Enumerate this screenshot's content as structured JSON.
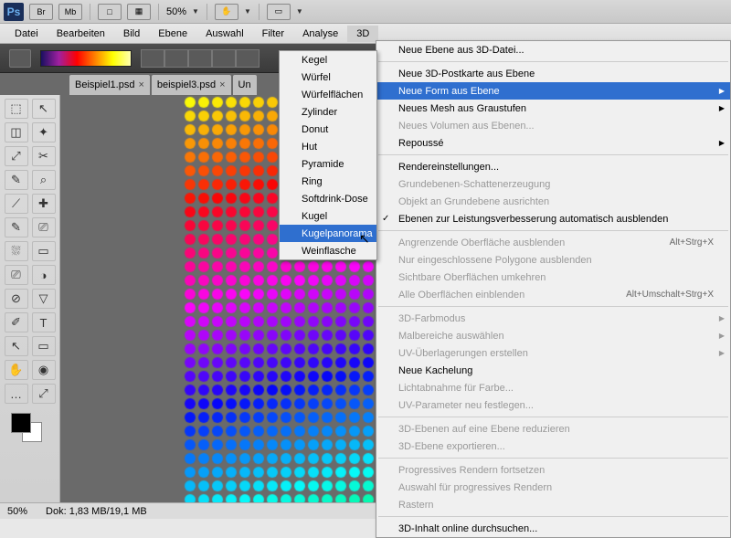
{
  "titlebar": {
    "logo": "Ps",
    "boxes": [
      "Br",
      "Mb",
      "□",
      "▦"
    ],
    "zoom": "50%"
  },
  "menubar": [
    "Datei",
    "Bearbeiten",
    "Bild",
    "Ebene",
    "Auswahl",
    "Filter",
    "Analyse",
    "3D"
  ],
  "tabs": [
    {
      "name": "Beispiel1.psd"
    },
    {
      "name": "beispiel3.psd"
    },
    {
      "name": "Un"
    }
  ],
  "menu3d": [
    {
      "label": "Neue Ebene aus 3D-Datei..."
    },
    {
      "sep": true
    },
    {
      "label": "Neue 3D-Postkarte aus Ebene"
    },
    {
      "label": "Neue Form aus Ebene",
      "arrow": true,
      "highlighted": true
    },
    {
      "label": "Neues Mesh aus Graustufen",
      "arrow": true
    },
    {
      "label": "Neues Volumen aus Ebenen...",
      "disabled": true
    },
    {
      "label": "Repoussé",
      "arrow": true
    },
    {
      "sep": true
    },
    {
      "label": "Rendereinstellungen..."
    },
    {
      "label": "Grundebenen-Schattenerzeugung",
      "disabled": true
    },
    {
      "label": "Objekt an Grundebene ausrichten",
      "disabled": true
    },
    {
      "label": "Ebenen zur Leistungsverbesserung automatisch ausblenden",
      "checked": true
    },
    {
      "sep": true
    },
    {
      "label": "Angrenzende Oberfläche ausblenden",
      "disabled": true,
      "shortcut": "Alt+Strg+X"
    },
    {
      "label": "Nur eingeschlossene Polygone ausblenden",
      "disabled": true
    },
    {
      "label": "Sichtbare Oberflächen umkehren",
      "disabled": true
    },
    {
      "label": "Alle Oberflächen einblenden",
      "disabled": true,
      "shortcut": "Alt+Umschalt+Strg+X"
    },
    {
      "sep": true
    },
    {
      "label": "3D-Farbmodus",
      "arrow": true,
      "disabled": true
    },
    {
      "label": "Malbereiche auswählen",
      "arrow": true,
      "disabled": true
    },
    {
      "label": "UV-Überlagerungen erstellen",
      "arrow": true,
      "disabled": true
    },
    {
      "label": "Neue Kachelung"
    },
    {
      "label": "Lichtabnahme für Farbe...",
      "disabled": true
    },
    {
      "label": "UV-Parameter neu festlegen...",
      "disabled": true
    },
    {
      "sep": true
    },
    {
      "label": "3D-Ebenen auf eine Ebene reduzieren",
      "disabled": true
    },
    {
      "label": "3D-Ebene exportieren...",
      "disabled": true
    },
    {
      "sep": true
    },
    {
      "label": "Progressives Rendern fortsetzen",
      "disabled": true
    },
    {
      "label": "Auswahl für progressives Rendern",
      "disabled": true
    },
    {
      "label": "Rastern",
      "disabled": true
    },
    {
      "sep": true
    },
    {
      "label": "3D-Inhalt online durchsuchen..."
    }
  ],
  "menuShapes": [
    {
      "label": "Kegel"
    },
    {
      "label": "Würfel"
    },
    {
      "label": "Würfelflächen"
    },
    {
      "label": "Zylinder"
    },
    {
      "label": "Donut"
    },
    {
      "label": "Hut"
    },
    {
      "label": "Pyramide"
    },
    {
      "label": "Ring"
    },
    {
      "label": "Softdrink-Dose"
    },
    {
      "label": "Kugel"
    },
    {
      "label": "Kugelpanorama",
      "highlighted": true
    },
    {
      "label": "Weinflasche"
    }
  ],
  "tools": [
    [
      "⬚",
      "↖"
    ],
    [
      "◫",
      "✦"
    ],
    [
      "⤢",
      "✂"
    ],
    [
      "✎",
      "⌕"
    ],
    [
      "⟋",
      "✚"
    ],
    [
      "✎",
      "⎚"
    ],
    [
      "⛆",
      "▭"
    ],
    [
      "⎚",
      "◑"
    ],
    [
      "⊘",
      "▽"
    ],
    [
      "✐",
      "T"
    ],
    [
      "↖",
      "▭"
    ],
    [
      "✋",
      "◉"
    ],
    [
      "…",
      "⤢"
    ]
  ],
  "status": {
    "zoom": "50%",
    "doc": "Dok: 1,83 MB/19,1 MB"
  }
}
